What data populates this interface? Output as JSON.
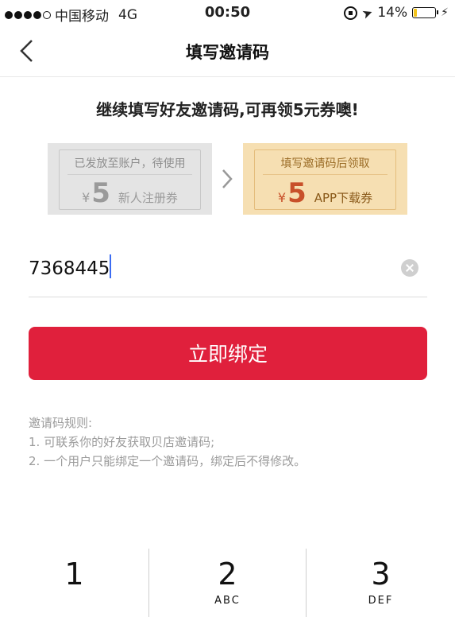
{
  "status_bar": {
    "carrier": "中国移动",
    "network": "4G",
    "time": "00:50",
    "battery_percent": "14%",
    "battery_level": 0.14,
    "battery_color": "#f3c31a",
    "icons": [
      "rotation-lock-icon",
      "location-arrow-icon",
      "battery-icon",
      "charging-bolt-icon"
    ]
  },
  "nav": {
    "title": "填写邀请码",
    "back_icon": "chevron-left-icon"
  },
  "headline": "继续填写好友邀请码,可再领5元券噢!",
  "coupons": [
    {
      "top_text": "已发放至账户，待使用",
      "currency": "¥",
      "amount": "5",
      "label": "新人注册券",
      "color": "#e4e4e4"
    },
    {
      "top_text": "填写邀请码后领取",
      "currency": "¥",
      "amount": "5",
      "label": "APP下载券",
      "color": "#f6dfb2"
    }
  ],
  "invite_input": {
    "value": "7368445",
    "clear_icon": "clear-icon"
  },
  "bind_button": {
    "label": "立即绑定",
    "color": "#e0203c"
  },
  "rules": {
    "title": "邀请码规则:",
    "items": [
      "1. 可联系你的好友获取贝店邀请码;",
      "2. 一个用户只能绑定一个邀请码，绑定后不得修改。"
    ]
  },
  "keyboard": {
    "keys": [
      {
        "number": "1",
        "letters": ""
      },
      {
        "number": "2",
        "letters": "ABC"
      },
      {
        "number": "3",
        "letters": "DEF"
      }
    ]
  }
}
